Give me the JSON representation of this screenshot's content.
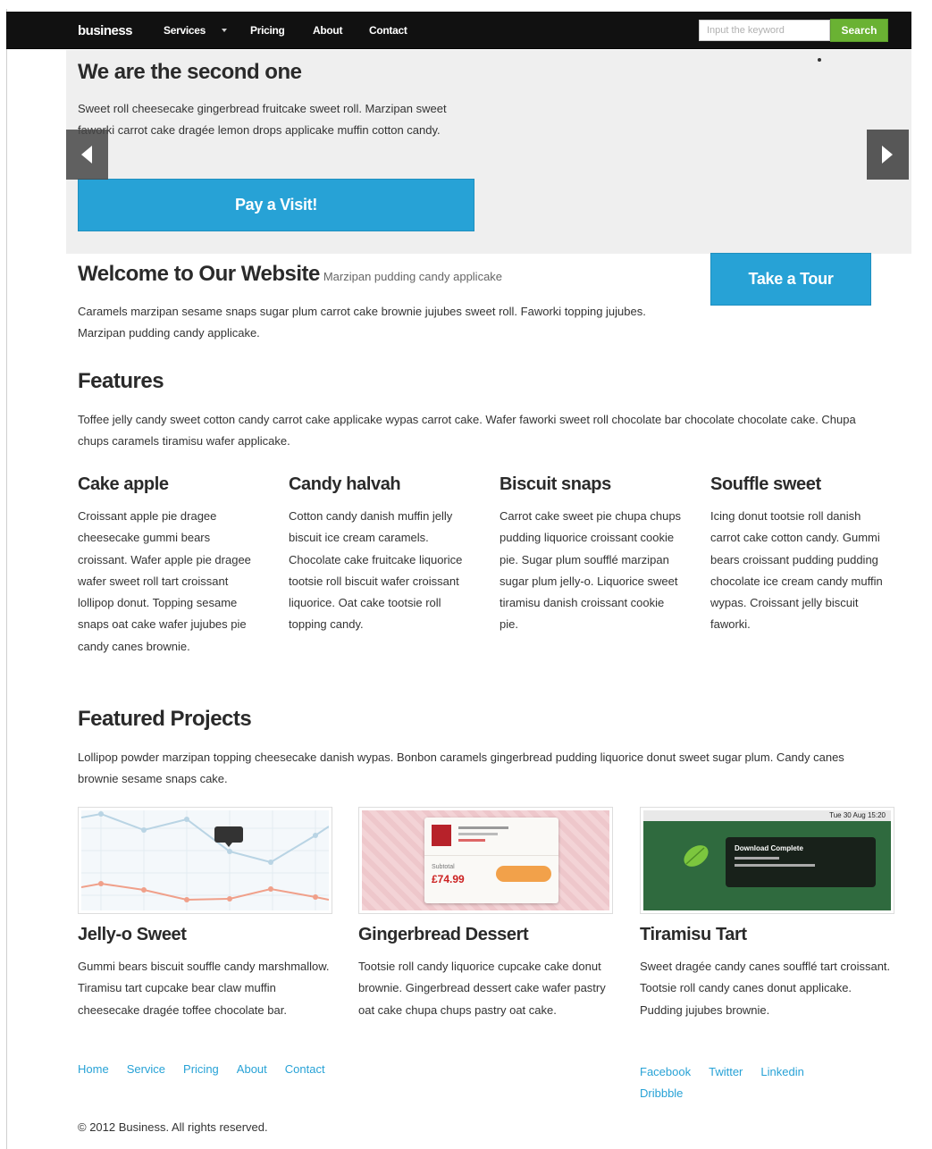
{
  "navbar": {
    "brand": "business",
    "items": [
      "Services",
      "Pricing",
      "About",
      "Contact"
    ],
    "search_placeholder": "Input the keyword",
    "search_label": "Search"
  },
  "hero": {
    "title": "We are the second one",
    "text": "Sweet roll cheesecake gingerbread fruitcake sweet roll. Marzipan sweet faworki carrot cake dragée lemon drops applicake muffin cotton candy.",
    "cta": "Pay a Visit!"
  },
  "welcome": {
    "title": "Welcome to Our Website",
    "subtitle": "Marzipan pudding candy applicake",
    "text": "Caramels marzipan sesame snaps sugar plum carrot cake brownie jujubes sweet roll. Faworki topping jujubes. Marzipan pudding candy applicake.",
    "tour": "Take a Tour"
  },
  "features": {
    "title": "Features",
    "text": "Toffee jelly candy sweet cotton candy carrot cake applicake wypas carrot cake. Wafer faworki sweet roll chocolate bar chocolate chocolate cake. Chupa chups caramels tiramisu wafer applicake.",
    "items": [
      {
        "title": "Cake apple",
        "text": "Croissant apple pie dragee cheesecake gummi bears croissant. Wafer apple pie dragee wafer sweet roll tart croissant lollipop donut. Topping sesame snaps oat cake wafer jujubes pie candy canes brownie."
      },
      {
        "title": "Candy halvah",
        "text": "Cotton candy danish muffin jelly biscuit ice cream caramels. Chocolate cake fruitcake liquorice tootsie roll biscuit wafer croissant liquorice. Oat cake tootsie roll topping candy."
      },
      {
        "title": "Biscuit snaps",
        "text": "Carrot cake sweet pie chupa chups pudding liquorice croissant cookie pie. Sugar plum soufflé marzipan sugar plum jelly-o. Liquorice sweet tiramisu danish croissant cookie pie."
      },
      {
        "title": "Souffle sweet",
        "text": "Icing donut tootsie roll danish carrot cake cotton candy. Gummi bears croissant pudding pudding chocolate ice cream candy muffin wypas. Croissant jelly biscuit faworki."
      }
    ]
  },
  "projects": {
    "title": "Featured Projects",
    "text": "Lollipop powder marzipan topping cheesecake danish wypas. Bonbon caramels gingerbread pudding liquorice donut sweet sugar plum. Candy canes brownie sesame snaps cake.",
    "items": [
      {
        "title": "Jelly-o Sweet",
        "text": "Gummi bears biscuit souffle candy marshmallow. Tiramisu tart cupcake bear claw muffin cheesecake dragée toffee chocolate bar."
      },
      {
        "title": "Gingerbread Dessert",
        "text": "Tootsie roll candy liquorice cupcake cake donut brownie. Gingerbread dessert cake wafer pastry oat cake chupa chups pastry oat cake."
      },
      {
        "title": "Tiramisu Tart",
        "text": "Sweet dragée candy canes soufflé tart croissant. Tootsie roll candy canes donut applicake. Pudding jujubes brownie."
      }
    ],
    "thumb2": {
      "total_label": "Subtotal",
      "price": "£74.99"
    },
    "thumb3": {
      "clock": "Tue 30 Aug 15:20",
      "note_title": "Download Complete"
    }
  },
  "footer": {
    "links": [
      "Home",
      "Service",
      "Pricing",
      "About",
      "Contact"
    ],
    "social": [
      "Facebook",
      "Twitter",
      "Linkedin",
      "Dribbble"
    ],
    "copyright": "© 2012 Business. All rights reserved."
  }
}
